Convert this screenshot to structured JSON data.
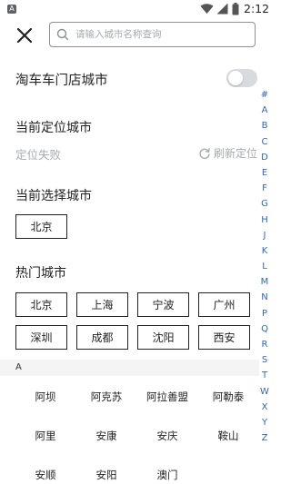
{
  "status_bar": {
    "app_icon": "A",
    "time": "2:12",
    "icons": [
      "wifi-icon",
      "signal-icon",
      "battery-icon"
    ]
  },
  "header": {
    "search": {
      "placeholder": "请输入城市名称查询",
      "value": ""
    }
  },
  "store_filter": {
    "label": "淘车车门店城市",
    "enabled": false
  },
  "current_location": {
    "title": "当前定位城市",
    "status": "定位失败",
    "refresh_label": "刷新定位"
  },
  "current_selection": {
    "title": "当前选择城市",
    "city": "北京"
  },
  "hot_cities": {
    "title": "热门城市",
    "cities": [
      "北京",
      "上海",
      "宁波",
      "广州",
      "深圳",
      "成都",
      "沈阳",
      "西安"
    ]
  },
  "groups": [
    {
      "letter": "A",
      "cities": [
        "阿坝",
        "阿克苏",
        "阿拉善盟",
        "阿勒泰",
        "阿里",
        "安康",
        "安庆",
        "鞍山",
        "安顺",
        "安阳",
        "澳门"
      ]
    }
  ],
  "index_letters": [
    "#",
    "A",
    "B",
    "C",
    "D",
    "E",
    "F",
    "G",
    "H",
    "J",
    "K",
    "L",
    "M",
    "N",
    "P",
    "Q",
    "R",
    "S",
    "T",
    "W",
    "X",
    "Y",
    "Z"
  ],
  "colors": {
    "accent": "#2b66c4",
    "muted": "#a7abb1",
    "toggle_off": "#d8dadd",
    "group_bg": "#f4f4f4"
  }
}
